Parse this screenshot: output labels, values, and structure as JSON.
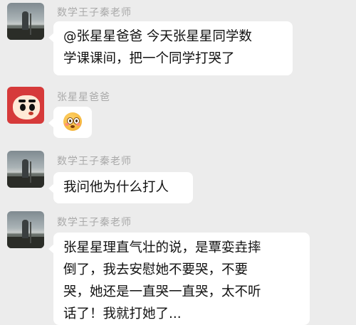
{
  "messages": [
    {
      "sender": "数学王子秦老师",
      "lines": [
        "@张星星爸爸 今天张星星同学数",
        "学课课间，把一个同学打哭了"
      ]
    },
    {
      "sender": "张星星爸爸",
      "emoji": "flushed-face-icon"
    },
    {
      "sender": "数学王子秦老师",
      "lines": [
        "我问他为什么打人"
      ]
    },
    {
      "sender": "数学王子秦老师",
      "lines": [
        "张星星理直气壮的说，是覃娈垚摔",
        "倒了，我去安慰她不要哭，不要",
        "哭，她还是一直哭一直哭，太不听",
        "话了！我就打她了..."
      ]
    }
  ]
}
